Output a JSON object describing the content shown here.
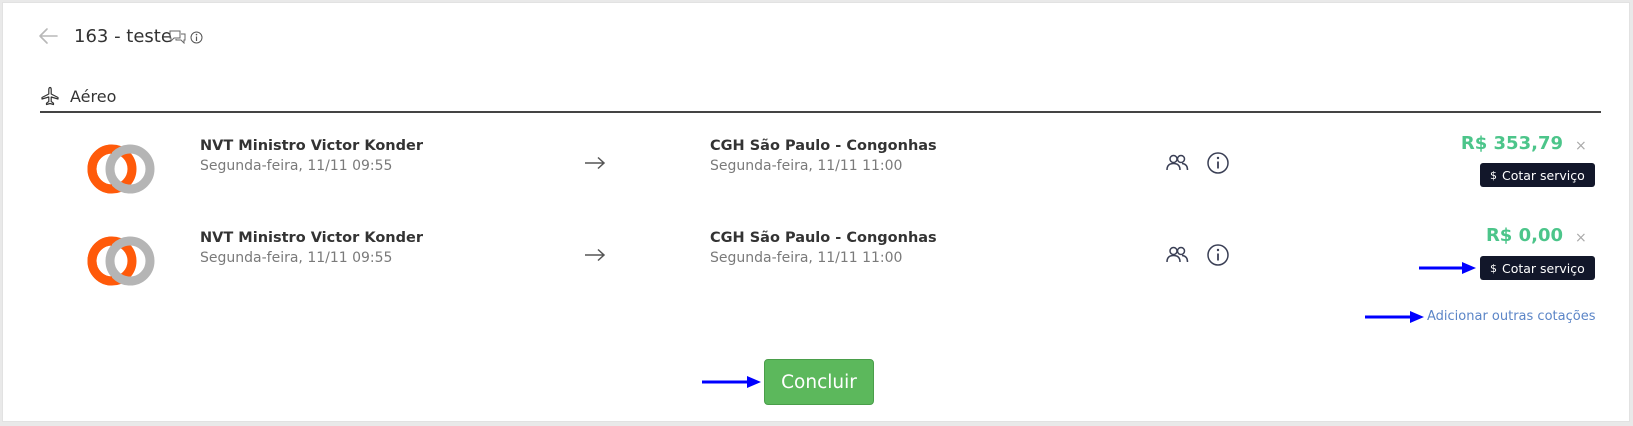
{
  "header": {
    "title": "163 - teste",
    "back_icon": "arrow-left-icon"
  },
  "section": {
    "label": "Aéreo",
    "icon": "airplane-icon"
  },
  "flights": [
    {
      "origin_name": "NVT Ministro Victor Konder",
      "origin_date": "Segunda-feira, 11/11 09:55",
      "dest_name": "CGH São Paulo - Congonhas",
      "dest_date": "Segunda-feira, 11/11 11:00",
      "price": "R$ 353,79",
      "remove": "×",
      "quote_label": "Cotar serviço",
      "quote_icon": "$"
    },
    {
      "origin_name": "NVT Ministro Victor Konder",
      "origin_date": "Segunda-feira, 11/11 09:55",
      "dest_name": "CGH São Paulo - Congonhas",
      "dest_date": "Segunda-feira, 11/11 11:00",
      "price": "R$ 0,00",
      "remove": "×",
      "quote_label": "Cotar serviço",
      "quote_icon": "$"
    }
  ],
  "add_quotes_link": "Adicionar outras cotações",
  "conclude_button": "Concluir",
  "colors": {
    "price_green": "#4cc58a",
    "button_green": "#5cb85c",
    "dark_button": "#12172a",
    "link_blue": "#5b85c7",
    "annotation_blue": "#0000ff",
    "logo_orange": "#ff5a0a",
    "logo_gray": "#b5b5b5"
  }
}
